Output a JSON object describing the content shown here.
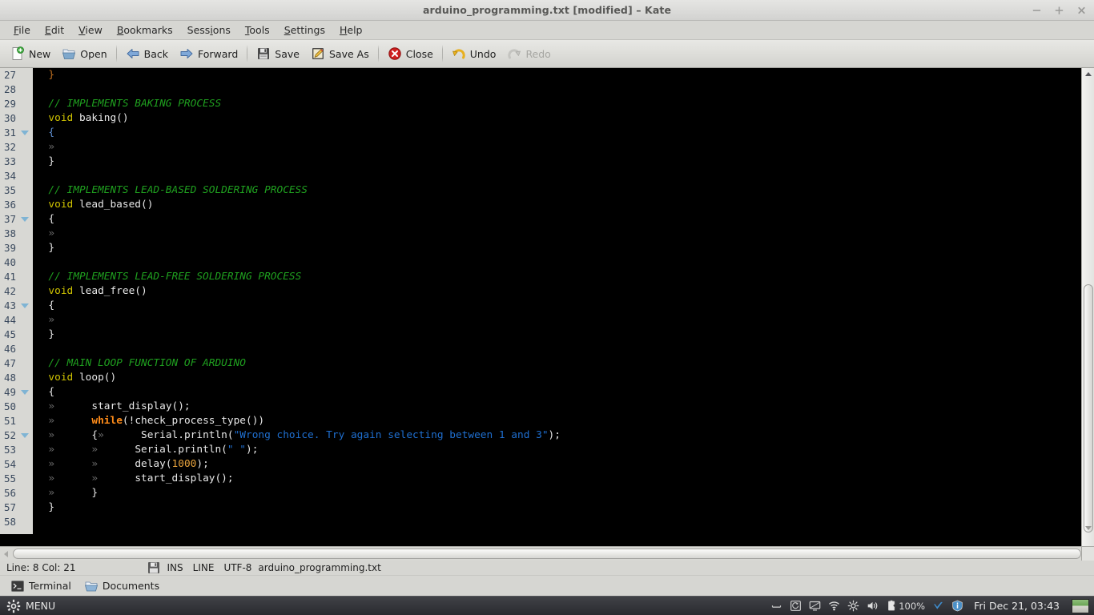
{
  "window": {
    "title": "arduino_programming.txt [modified] – Kate",
    "controls": [
      {
        "name": "minimize",
        "glyph": "−"
      },
      {
        "name": "maximize",
        "glyph": "+"
      },
      {
        "name": "close",
        "glyph": "✖"
      }
    ]
  },
  "menubar": {
    "items": [
      {
        "label": "File",
        "mnemonic": "F"
      },
      {
        "label": "Edit",
        "mnemonic": "E"
      },
      {
        "label": "View",
        "mnemonic": "V"
      },
      {
        "label": "Bookmarks",
        "mnemonic": "B"
      },
      {
        "label": "Sessions",
        "mnemonic": "i"
      },
      {
        "label": "Tools",
        "mnemonic": "T"
      },
      {
        "label": "Settings",
        "mnemonic": "S"
      },
      {
        "label": "Help",
        "mnemonic": "H"
      }
    ]
  },
  "toolbar": {
    "new_label": "New",
    "open_label": "Open",
    "back_label": "Back",
    "forward_label": "Forward",
    "save_label": "Save",
    "save_as_label": "Save As",
    "close_label": "Close",
    "undo_label": "Undo",
    "redo_label": "Redo",
    "redo_disabled": true
  },
  "editor": {
    "first_line_number": 27,
    "lines": [
      {
        "n": 27,
        "fold": false,
        "tokens": [
          {
            "t": "plain",
            "v": "  "
          },
          {
            "t": "brkt-close",
            "v": "}"
          }
        ]
      },
      {
        "n": 28,
        "fold": false,
        "tokens": []
      },
      {
        "n": 29,
        "fold": false,
        "tokens": [
          {
            "t": "plain",
            "v": "  "
          },
          {
            "t": "cmt",
            "v": "// IMPLEMENTS BAKING PROCESS"
          }
        ]
      },
      {
        "n": 30,
        "fold": false,
        "tokens": [
          {
            "t": "plain",
            "v": "  "
          },
          {
            "t": "kw",
            "v": "void"
          },
          {
            "t": "plain",
            "v": " baking()"
          }
        ]
      },
      {
        "n": 31,
        "fold": true,
        "tokens": [
          {
            "t": "plain",
            "v": "  "
          },
          {
            "t": "brkt-open",
            "v": "{"
          }
        ]
      },
      {
        "n": 32,
        "fold": false,
        "tokens": [
          {
            "t": "plain",
            "v": "  "
          },
          {
            "t": "tab",
            "v": "»"
          }
        ]
      },
      {
        "n": 33,
        "fold": false,
        "tokens": [
          {
            "t": "plain",
            "v": "  "
          },
          {
            "t": "plain",
            "v": "}"
          }
        ]
      },
      {
        "n": 34,
        "fold": false,
        "tokens": []
      },
      {
        "n": 35,
        "fold": false,
        "tokens": [
          {
            "t": "plain",
            "v": "  "
          },
          {
            "t": "cmt",
            "v": "// IMPLEMENTS LEAD-BASED SOLDERING PROCESS"
          }
        ]
      },
      {
        "n": 36,
        "fold": false,
        "tokens": [
          {
            "t": "plain",
            "v": "  "
          },
          {
            "t": "kw",
            "v": "void"
          },
          {
            "t": "plain",
            "v": " lead_based()"
          }
        ]
      },
      {
        "n": 37,
        "fold": true,
        "tokens": [
          {
            "t": "plain",
            "v": "  "
          },
          {
            "t": "plain",
            "v": "{"
          }
        ]
      },
      {
        "n": 38,
        "fold": false,
        "tokens": [
          {
            "t": "plain",
            "v": "  "
          },
          {
            "t": "tab",
            "v": "»"
          }
        ]
      },
      {
        "n": 39,
        "fold": false,
        "tokens": [
          {
            "t": "plain",
            "v": "  "
          },
          {
            "t": "plain",
            "v": "}"
          }
        ]
      },
      {
        "n": 40,
        "fold": false,
        "tokens": []
      },
      {
        "n": 41,
        "fold": false,
        "tokens": [
          {
            "t": "plain",
            "v": "  "
          },
          {
            "t": "cmt",
            "v": "// IMPLEMENTS LEAD-FREE SOLDERING PROCESS"
          }
        ]
      },
      {
        "n": 42,
        "fold": false,
        "tokens": [
          {
            "t": "plain",
            "v": "  "
          },
          {
            "t": "kw",
            "v": "void"
          },
          {
            "t": "plain",
            "v": " lead_free()"
          }
        ]
      },
      {
        "n": 43,
        "fold": true,
        "tokens": [
          {
            "t": "plain",
            "v": "  "
          },
          {
            "t": "plain",
            "v": "{"
          }
        ]
      },
      {
        "n": 44,
        "fold": false,
        "tokens": [
          {
            "t": "plain",
            "v": "  "
          },
          {
            "t": "tab",
            "v": "»"
          }
        ]
      },
      {
        "n": 45,
        "fold": false,
        "tokens": [
          {
            "t": "plain",
            "v": "  "
          },
          {
            "t": "plain",
            "v": "}"
          }
        ]
      },
      {
        "n": 46,
        "fold": false,
        "tokens": []
      },
      {
        "n": 47,
        "fold": false,
        "tokens": [
          {
            "t": "plain",
            "v": "  "
          },
          {
            "t": "cmt",
            "v": "// MAIN LOOP FUNCTION OF ARDUINO"
          }
        ]
      },
      {
        "n": 48,
        "fold": false,
        "tokens": [
          {
            "t": "plain",
            "v": "  "
          },
          {
            "t": "kw",
            "v": "void"
          },
          {
            "t": "plain",
            "v": " loop()"
          }
        ]
      },
      {
        "n": 49,
        "fold": true,
        "tokens": [
          {
            "t": "plain",
            "v": "  "
          },
          {
            "t": "plain",
            "v": "{"
          }
        ]
      },
      {
        "n": 50,
        "fold": false,
        "tokens": [
          {
            "t": "plain",
            "v": "  "
          },
          {
            "t": "tab",
            "v": "»"
          },
          {
            "t": "plain",
            "v": "      start_display();"
          }
        ]
      },
      {
        "n": 51,
        "fold": false,
        "tokens": [
          {
            "t": "plain",
            "v": "  "
          },
          {
            "t": "tab",
            "v": "»"
          },
          {
            "t": "plain",
            "v": "      "
          },
          {
            "t": "kw2",
            "v": "while"
          },
          {
            "t": "plain",
            "v": "(!check_process_type())"
          }
        ]
      },
      {
        "n": 52,
        "fold": true,
        "tokens": [
          {
            "t": "plain",
            "v": "  "
          },
          {
            "t": "tab",
            "v": "»"
          },
          {
            "t": "plain",
            "v": "      {"
          },
          {
            "t": "tab",
            "v": "»"
          },
          {
            "t": "plain",
            "v": "      Serial.println("
          },
          {
            "t": "str",
            "v": "\"Wrong choice. Try again selecting between 1 and 3\""
          },
          {
            "t": "plain",
            "v": ");"
          }
        ]
      },
      {
        "n": 53,
        "fold": false,
        "tokens": [
          {
            "t": "plain",
            "v": "  "
          },
          {
            "t": "tab",
            "v": "»"
          },
          {
            "t": "plain",
            "v": "      "
          },
          {
            "t": "tab",
            "v": "»"
          },
          {
            "t": "plain",
            "v": "      Serial.println("
          },
          {
            "t": "str",
            "v": "\" \""
          },
          {
            "t": "plain",
            "v": ");"
          }
        ]
      },
      {
        "n": 54,
        "fold": false,
        "tokens": [
          {
            "t": "plain",
            "v": "  "
          },
          {
            "t": "tab",
            "v": "»"
          },
          {
            "t": "plain",
            "v": "      "
          },
          {
            "t": "tab",
            "v": "»"
          },
          {
            "t": "plain",
            "v": "      delay("
          },
          {
            "t": "num",
            "v": "1000"
          },
          {
            "t": "plain",
            "v": ");"
          }
        ]
      },
      {
        "n": 55,
        "fold": false,
        "tokens": [
          {
            "t": "plain",
            "v": "  "
          },
          {
            "t": "tab",
            "v": "»"
          },
          {
            "t": "plain",
            "v": "      "
          },
          {
            "t": "tab",
            "v": "»"
          },
          {
            "t": "plain",
            "v": "      start_display();"
          }
        ]
      },
      {
        "n": 56,
        "fold": false,
        "tokens": [
          {
            "t": "plain",
            "v": "  "
          },
          {
            "t": "tab",
            "v": "»"
          },
          {
            "t": "plain",
            "v": "      }"
          }
        ]
      },
      {
        "n": 57,
        "fold": false,
        "tokens": [
          {
            "t": "plain",
            "v": "  "
          },
          {
            "t": "plain",
            "v": "}"
          }
        ]
      },
      {
        "n": 58,
        "fold": false,
        "tokens": []
      }
    ]
  },
  "statusbar": {
    "position": "Line: 8 Col: 21",
    "insert_mode": "INS",
    "selection_mode": "LINE",
    "encoding": "UTF-8",
    "filename": "arduino_programming.txt"
  },
  "doctabs": {
    "items": [
      {
        "label": "Terminal",
        "icon": "terminal-icon"
      },
      {
        "label": "Documents",
        "icon": "documents-icon"
      }
    ]
  },
  "taskbar": {
    "menu_label": "MENU",
    "battery_percent": "100%",
    "clock": "Fri Dec 21, 03:43",
    "tray_icons": [
      "keyboard-icon",
      "screen-rotation-icon",
      "display-icon",
      "wifi-icon",
      "brightness-icon",
      "volume-icon",
      "battery-icon",
      "updates-icon",
      "info-icon"
    ]
  },
  "colors": {
    "comment": "#1fa01f",
    "keyword": "#cfc300",
    "control_keyword": "#ff8c19",
    "string": "#1f6fd0",
    "number": "#e8a33d",
    "editor_bg": "#000000",
    "editor_fg": "#e8e8e8",
    "gutter_bg": "#d8d8d4",
    "linenum_fg": "#3b4a5e"
  }
}
